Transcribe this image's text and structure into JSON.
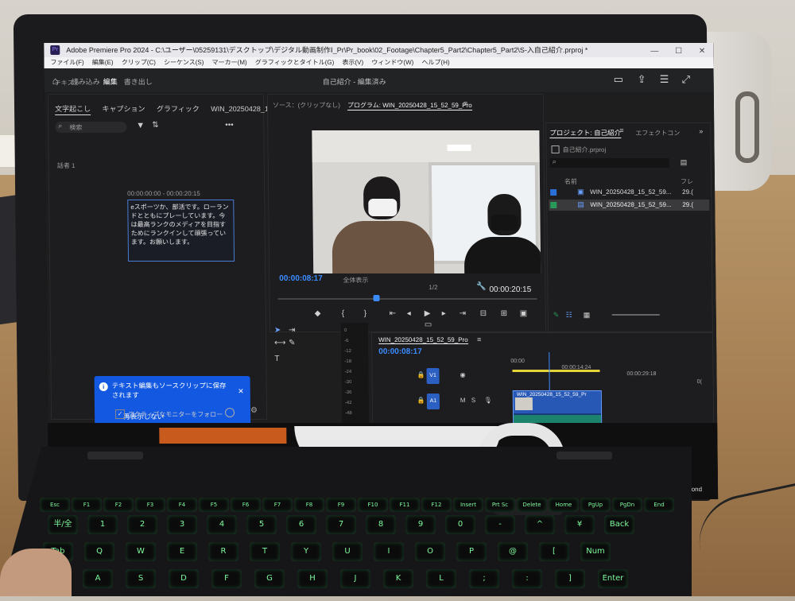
{
  "app": {
    "title": "Adobe Premiere Pro 2024 - C:\\ユーザー\\05259131\\デスクトップ\\デジタル動画制作Ⅰ_Pr\\Pr_book\\02_Footage\\Chapter5_Part2\\Chapter5_Part2\\S-入自己紹介.prproj *",
    "logo": "Pr",
    "menu": [
      "ファイル(F)",
      "編集(E)",
      "クリップ(C)",
      "シーケンス(S)",
      "マーカー(M)",
      "グラフィックとタイトル(G)",
      "表示(V)",
      "ウィンドウ(W)",
      "ヘルプ(H)"
    ],
    "workspace_tabs": [
      "読み込み",
      "編集",
      "書き出し"
    ],
    "project_title": "自己紹介 - 編集済み"
  },
  "text_panel": {
    "panel_title": "テキスト",
    "tabs": [
      "文字起こし",
      "キャプション",
      "グラフィック",
      "WIN_20250428_15_52_59_Pr"
    ],
    "search_placeholder": "検索",
    "speaker": "話者 1",
    "timecode_range": "00:00:00:00 - 00:00:20:15",
    "caption_text": "eスポーツか、部活です。ローランドとともにプレーしています。今は最高ランクのメディアを目指すためにランクインして頑張っています。お願いします。",
    "notice_text": "テキスト編集もソースクリップに保存されます",
    "notice_link": "再表示しない",
    "follow_monitor": "アクティブなモニターをフォロー"
  },
  "monitor": {
    "source_tab": "ソース：(クリップなし)",
    "program_tab": "プログラム: WIN_20250428_15_52_59_Pro",
    "timecode_current": "00:00:08:17",
    "zoom": "全体表示",
    "resolution": "1/2",
    "timecode_duration": "00:00:20:15"
  },
  "project": {
    "tab": "プロジェクト: 自己紹介",
    "effects_tab": "エフェクトコン",
    "file": "自己紹介.prproj",
    "column_name": "名前",
    "column_rate": "フレ",
    "items": [
      {
        "name": "WIN_20250428_15_52_59...",
        "rate": "29.("
      },
      {
        "name": "WIN_20250428_15_52_59...",
        "rate": "29.("
      }
    ]
  },
  "timeline": {
    "sequence_tab": "WIN_20250428_15_52_59_Pro",
    "timecode": "00:00:08:17",
    "ruler": [
      "00:00",
      "00:00:14:24",
      "00:00:29:18",
      "0("
    ],
    "tracks": [
      "V1",
      "A1"
    ],
    "clip_label": "WIN_20250428_15_52_59_Pr",
    "meter_scale": [
      "0",
      "-6",
      "-12",
      "-18",
      "-24",
      "-30",
      "-36",
      "-42",
      "-48"
    ]
  },
  "laptop": {
    "tagline": "Worlds Beyond"
  },
  "keyboard": {
    "row1": [
      "Esc",
      "F1",
      "F2",
      "F3",
      "F4",
      "F5",
      "F6",
      "F7",
      "F8",
      "F9",
      "F10",
      "F11",
      "F12",
      "Insert",
      "Prt Sc",
      "Delete",
      "Home",
      "PgUp",
      "PgDn",
      "End"
    ],
    "row2": [
      "半/全",
      "1",
      "2",
      "3",
      "4",
      "5",
      "6",
      "7",
      "8",
      "9",
      "0",
      "-",
      "^",
      "¥",
      "Back"
    ],
    "row3": [
      "Tab",
      "Q",
      "W",
      "E",
      "R",
      "T",
      "Y",
      "U",
      "I",
      "O",
      "P",
      "@",
      "[",
      "Num"
    ],
    "row4": [
      "Caps",
      "A",
      "S",
      "D",
      "F",
      "G",
      "H",
      "J",
      "K",
      "L",
      ";",
      ":",
      "]",
      "Enter"
    ]
  },
  "colors": {
    "accent_blue": "#3b8cff",
    "notice_blue": "#1358e0",
    "key_glow": "#7dfc9c"
  }
}
